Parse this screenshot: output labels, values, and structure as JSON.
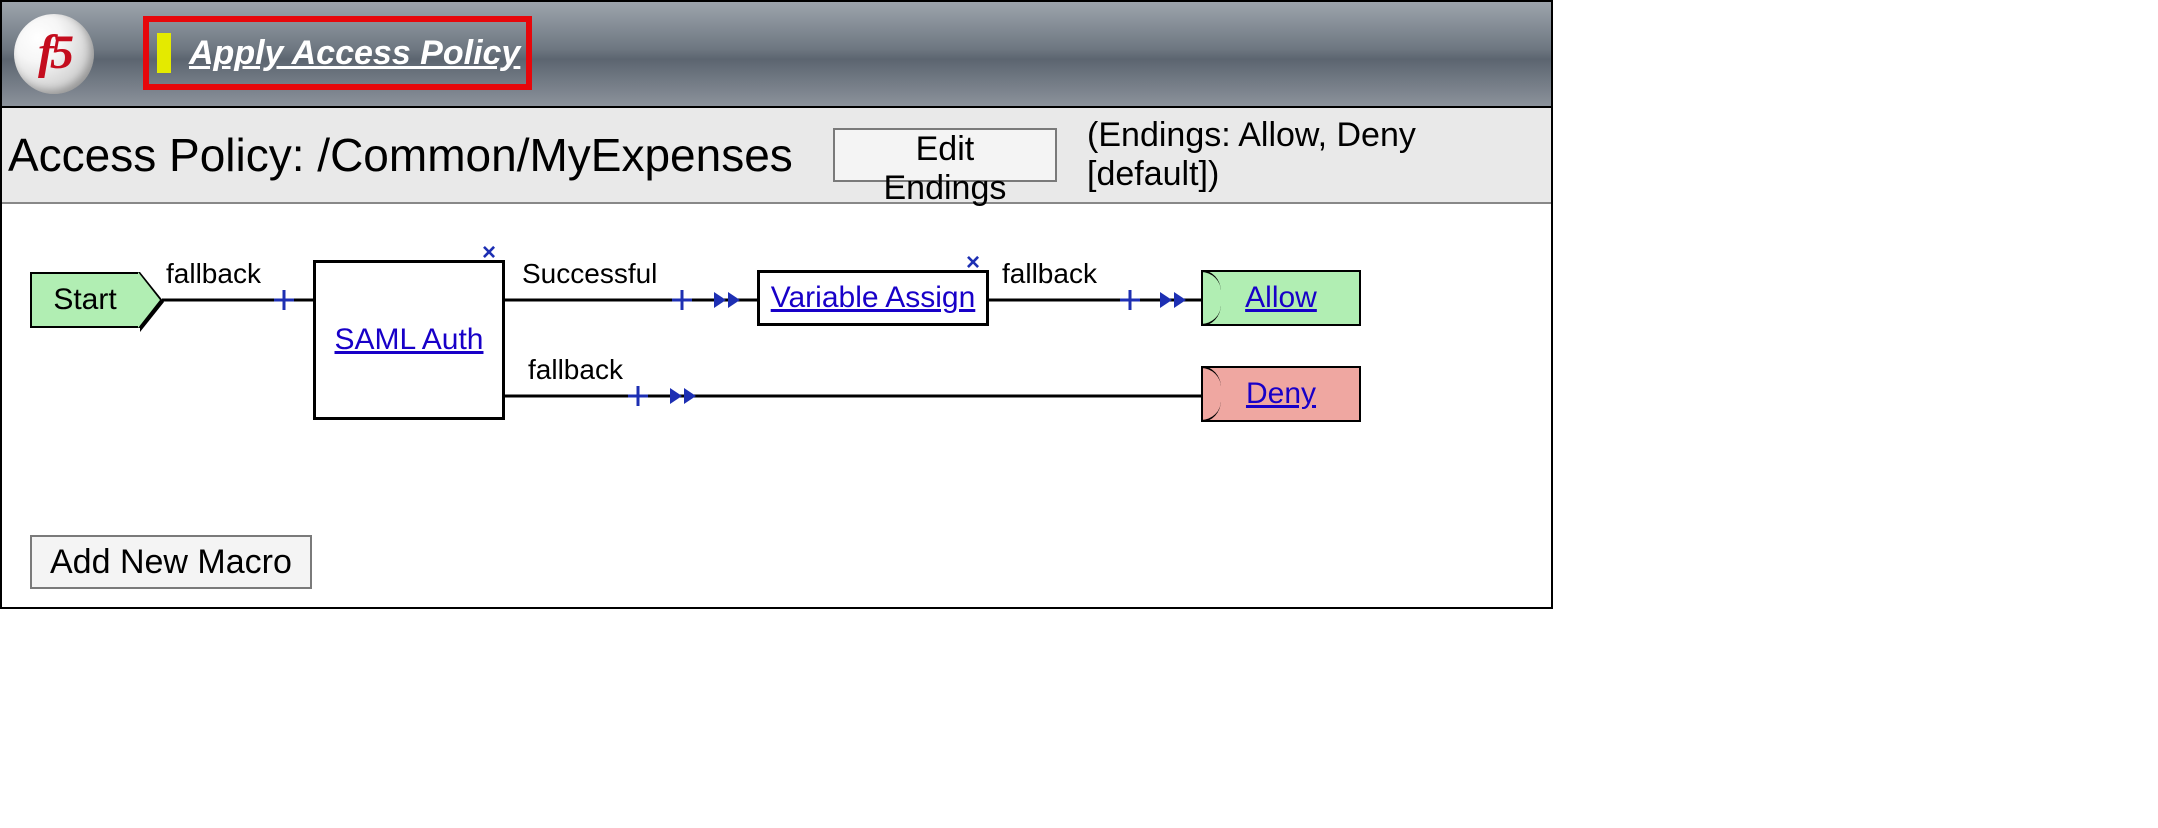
{
  "header": {
    "apply_label": "Apply Access Policy"
  },
  "title": "Access Policy: /Common/MyExpenses",
  "edit_endings_label": "Edit Endings",
  "endings_text": "(Endings: Allow, Deny [default])",
  "flow": {
    "start_label": "Start",
    "branch1_label": "fallback",
    "saml_label": "SAML Auth",
    "saml_success_label": "Successful",
    "saml_fallback_label": "fallback",
    "var_assign_label": "Variable Assign",
    "var_fallback_label": "fallback",
    "allow_label": "Allow",
    "deny_label": "Deny"
  },
  "add_macro_label": "Add New Macro"
}
